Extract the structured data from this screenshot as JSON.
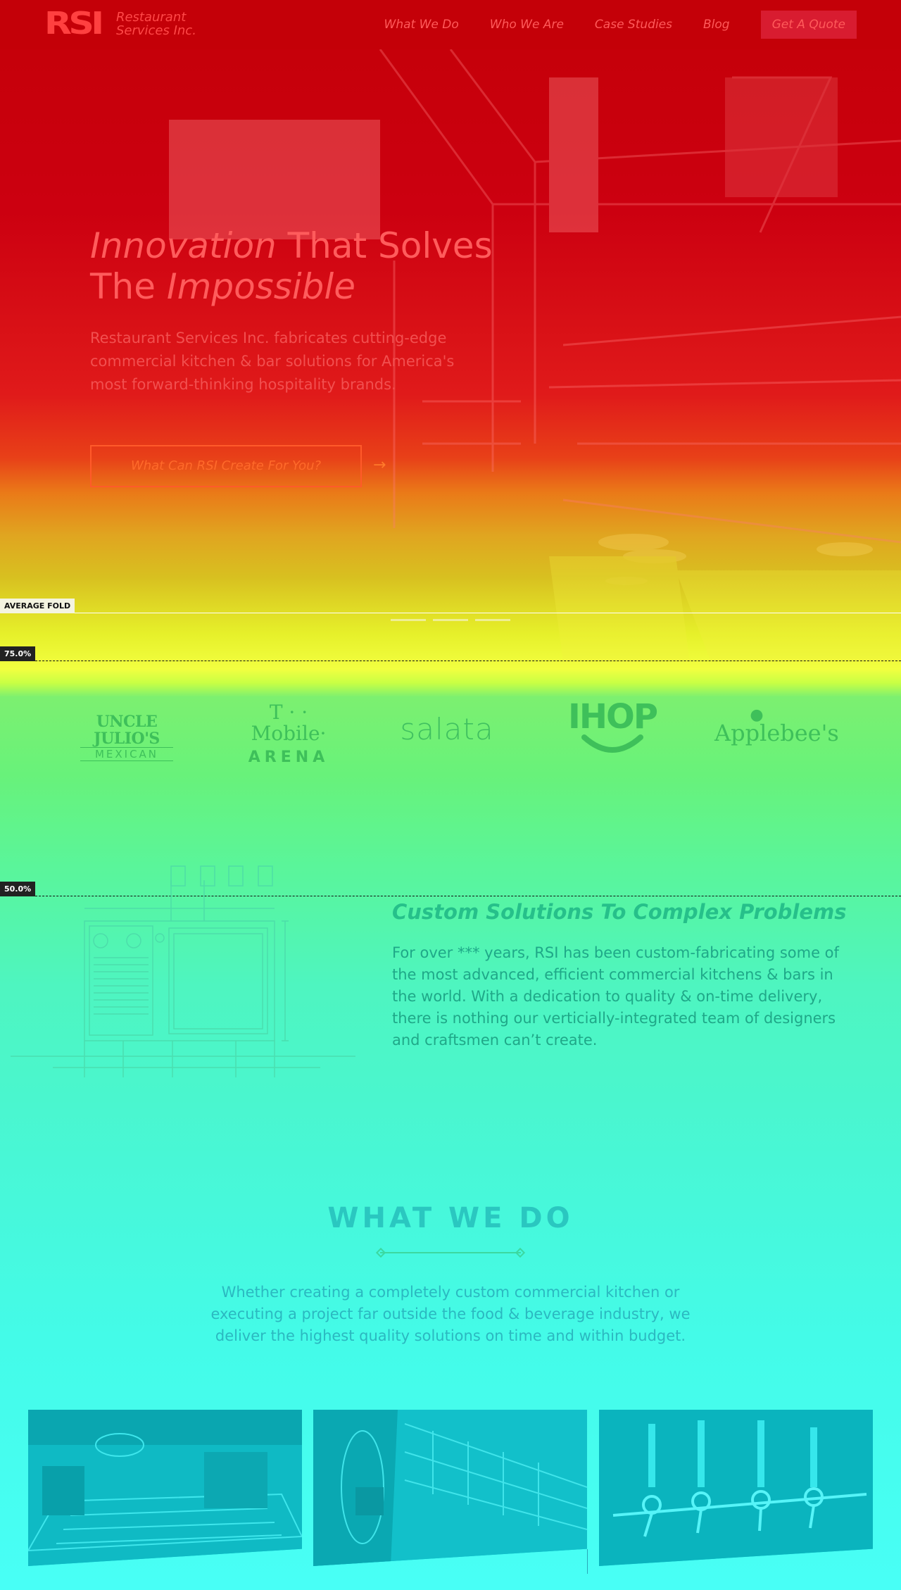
{
  "nav": {
    "logo_mark": "RSI",
    "logo_line1": "Restaurant",
    "logo_line2": "Services Inc.",
    "links": [
      "What We Do",
      "Who We Are",
      "Case Studies",
      "Blog"
    ],
    "cta": "Get A Quote"
  },
  "hero": {
    "title_italic_1": "Innovation",
    "title_plain_1": " That Solves",
    "title_plain_2": "The ",
    "title_italic_2": "Impossible",
    "subtitle": "Restaurant Services Inc. fabricates cutting-edge commercial kitchen & bar solutions for America's most forward-thinking hospitality brands.",
    "cta": "What Can RSI Create For You?",
    "cta_arrow": "→",
    "slide_count": 3
  },
  "overlay": {
    "average_fold": "AVERAGE FOLD",
    "pct_75": "75.0%",
    "pct_50": "50.0%"
  },
  "clients": {
    "uncle_julios_1": "UNCLE JULIO'S",
    "uncle_julios_2": "MEXICAN",
    "tmobile_1": "T · · Mobile·",
    "tmobile_2": "ARENA",
    "salata": "salata",
    "ihop": "IHOP",
    "applebees": "Applebee's"
  },
  "solutions": {
    "title": "Custom Solutions To Complex Problems",
    "body": "For over *** years, RSI has been custom-fabricating some of the most advanced, efficient commercial kitchens & bars in the world. With a dedication to quality & on-time delivery, there is nothing our verticially-integrated team of designers and craftsmen can’t create."
  },
  "what_we_do": {
    "title": "WHAT WE DO",
    "body": "Whether creating a completely custom commercial kitchen or executing a project far outside the food & beverage industry, we deliver the highest quality solutions on time and within budget."
  },
  "colors": {
    "nav_bg": "#c40008",
    "accent_red": "#ff4040",
    "heat_green": "#5af59a",
    "heat_cyan": "#48fff6"
  }
}
